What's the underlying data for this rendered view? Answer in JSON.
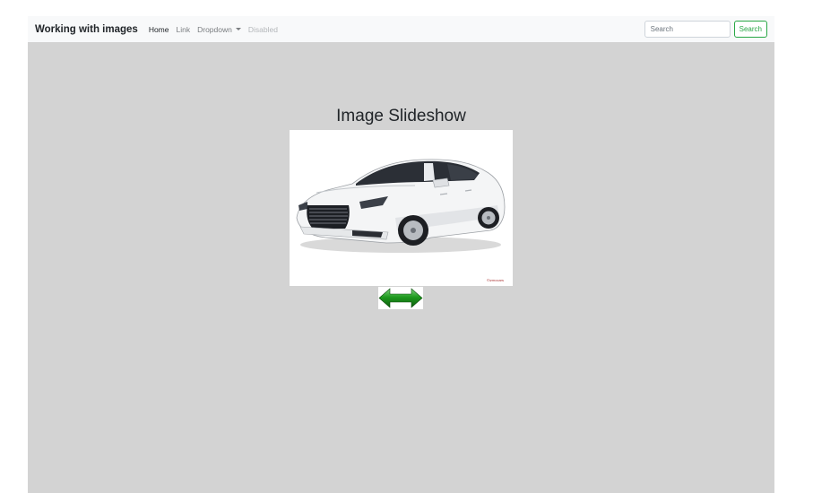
{
  "navbar": {
    "brand": "Working with images",
    "links": [
      {
        "label": "Home",
        "state": "active"
      },
      {
        "label": "Link",
        "state": "normal"
      },
      {
        "label": "Dropdown",
        "state": "dropdown"
      },
      {
        "label": "Disabled",
        "state": "disabled"
      }
    ],
    "search": {
      "placeholder": "Search",
      "button_label": "Search"
    }
  },
  "main": {
    "title": "Image Slideshow",
    "slide_image": "white-sedan-car",
    "watermark": "©izmocars",
    "controls_icon": "green-double-arrow-icon"
  },
  "colors": {
    "content_bg": "#d3d3d3",
    "navbar_bg": "#f8f9fa",
    "success": "#28a745",
    "arrow_green": "#1d8a1d"
  }
}
